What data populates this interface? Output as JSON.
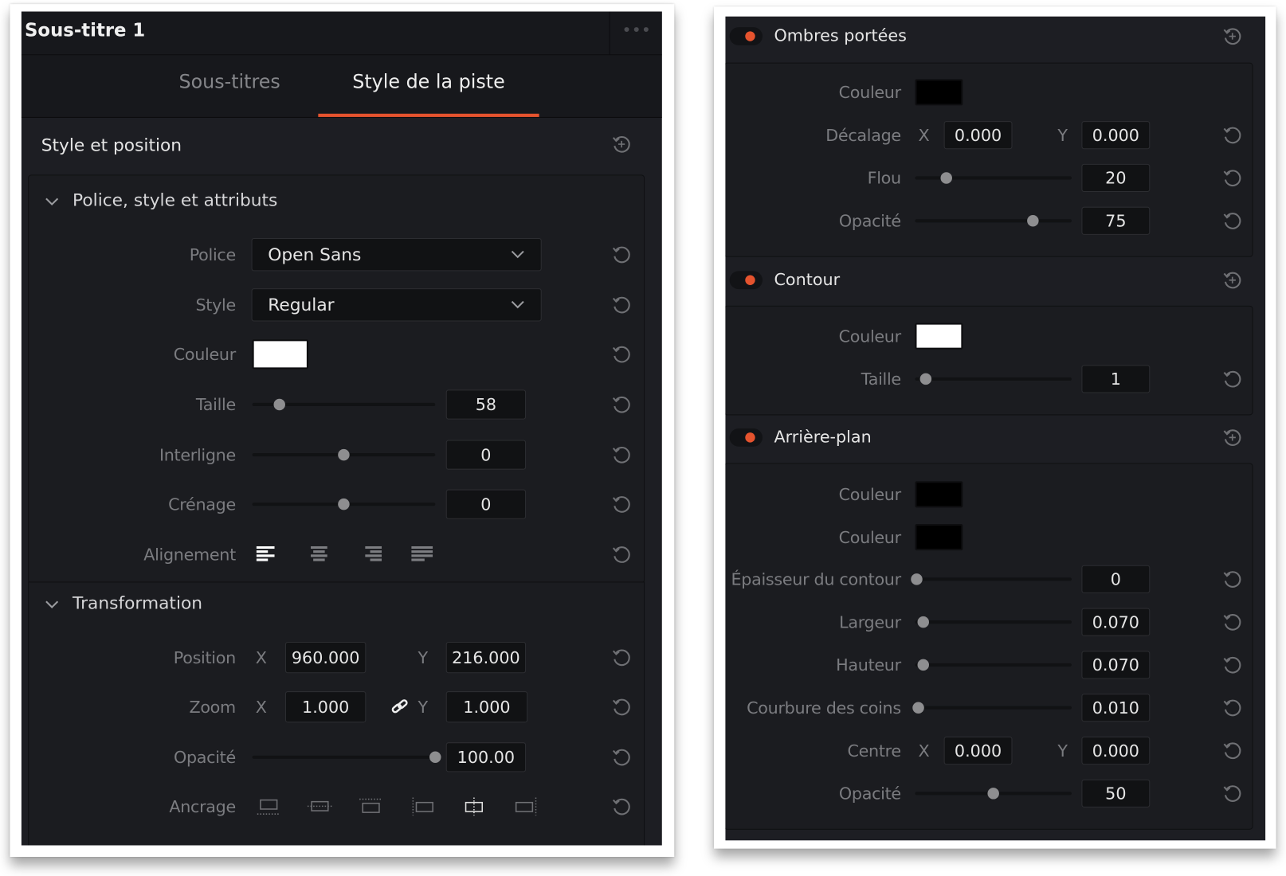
{
  "left": {
    "title": "Sous-titre 1",
    "more_icon": "ellipsis-icon",
    "tabs": [
      {
        "label": "Sous-titres",
        "active": false
      },
      {
        "label": "Style de la piste",
        "active": true
      }
    ],
    "accent": "#e5532e",
    "section_title": "Style et position",
    "groups": [
      {
        "title": "Police, style et attributs",
        "rows": [
          {
            "label": "Police",
            "type": "dropdown",
            "value": "Open Sans"
          },
          {
            "label": "Style",
            "type": "dropdown",
            "value": "Regular"
          },
          {
            "label": "Couleur",
            "type": "color",
            "value": "#ffffff"
          },
          {
            "label": "Taille",
            "type": "slider",
            "value": "58",
            "level": 0.15
          },
          {
            "label": "Interligne",
            "type": "slider",
            "value": "0",
            "level": 0.5
          },
          {
            "label": "Crénage",
            "type": "slider",
            "value": "0",
            "level": 0.5
          },
          {
            "label": "Alignement",
            "type": "align",
            "options": [
              "align-left",
              "align-center",
              "align-right",
              "justify"
            ],
            "selected": 0
          }
        ]
      },
      {
        "title": "Transformation",
        "rows": [
          {
            "label": "Position",
            "type": "xy",
            "x_label": "X",
            "x": "960.000",
            "y_label": "Y",
            "y": "216.000"
          },
          {
            "label": "Zoom",
            "type": "xy",
            "x_label": "X",
            "x": "1.000",
            "y_label": "Y",
            "y": "1.000",
            "linked": true
          },
          {
            "label": "Opacité",
            "type": "slider",
            "value": "100.00",
            "level": 1.0
          },
          {
            "label": "Ancrage",
            "type": "anchor",
            "options": [
              "anchor-bottom",
              "anchor-middle",
              "anchor-top",
              "anchor-left",
              "anchor-center",
              "anchor-right"
            ],
            "selected": 4
          }
        ]
      }
    ]
  },
  "right": {
    "sections": [
      {
        "title": "Ombres portées",
        "enabled": true,
        "rows": [
          {
            "label": "Couleur",
            "type": "color",
            "value": "#000000"
          },
          {
            "label": "Décalage",
            "type": "xy",
            "x_label": "X",
            "x": "0.000",
            "y_label": "Y",
            "y": "0.000"
          },
          {
            "label": "Flou",
            "type": "slider",
            "value": "20",
            "level": 0.2
          },
          {
            "label": "Opacité",
            "type": "slider",
            "value": "75",
            "level": 0.75
          }
        ]
      },
      {
        "title": "Contour",
        "enabled": true,
        "rows": [
          {
            "label": "Couleur",
            "type": "color",
            "value": "#ffffff"
          },
          {
            "label": "Taille",
            "type": "slider",
            "value": "1",
            "level": 0.07
          }
        ]
      },
      {
        "title": "Arrière-plan",
        "enabled": true,
        "rows": [
          {
            "label": "Couleur",
            "type": "color",
            "value": "#000000"
          },
          {
            "label": "Couleur",
            "type": "color",
            "value": "#000000"
          },
          {
            "label": "Épaisseur du contour",
            "type": "slider",
            "value": "0",
            "level": 0.01
          },
          {
            "label": "Largeur",
            "type": "slider",
            "value": "0.070",
            "level": 0.05
          },
          {
            "label": "Hauteur",
            "type": "slider",
            "value": "0.070",
            "level": 0.05
          },
          {
            "label": "Courbure des coins",
            "type": "slider",
            "value": "0.010",
            "level": 0.02
          },
          {
            "label": "Centre",
            "type": "xy",
            "x_label": "X",
            "x": "0.000",
            "y_label": "Y",
            "y": "0.000"
          },
          {
            "label": "Opacité",
            "type": "slider",
            "value": "50",
            "level": 0.5
          }
        ]
      }
    ]
  }
}
